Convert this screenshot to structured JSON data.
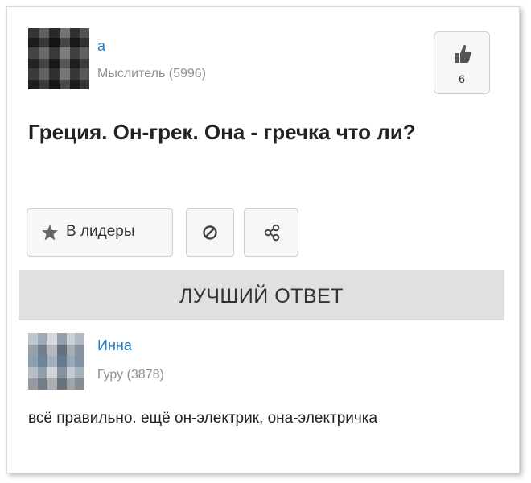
{
  "question": {
    "author": {
      "name": "а",
      "rank": "Мыслитель (5996)"
    },
    "likes": "6",
    "text": "Греция. Он-грек. Она - гречка что ли?",
    "actions": {
      "leaders_label": "В лидеры"
    }
  },
  "best_answer": {
    "banner": "ЛУЧШИЙ ОТВЕТ",
    "author": {
      "name": "Инна",
      "rank": "Гуру (3878)"
    },
    "text": "всё правильно. ещё он-электрик, она-электричка"
  },
  "colors": {
    "link": "#1e7bc4",
    "muted": "#8f8f8f",
    "banner_bg": "#e0e0e0"
  }
}
